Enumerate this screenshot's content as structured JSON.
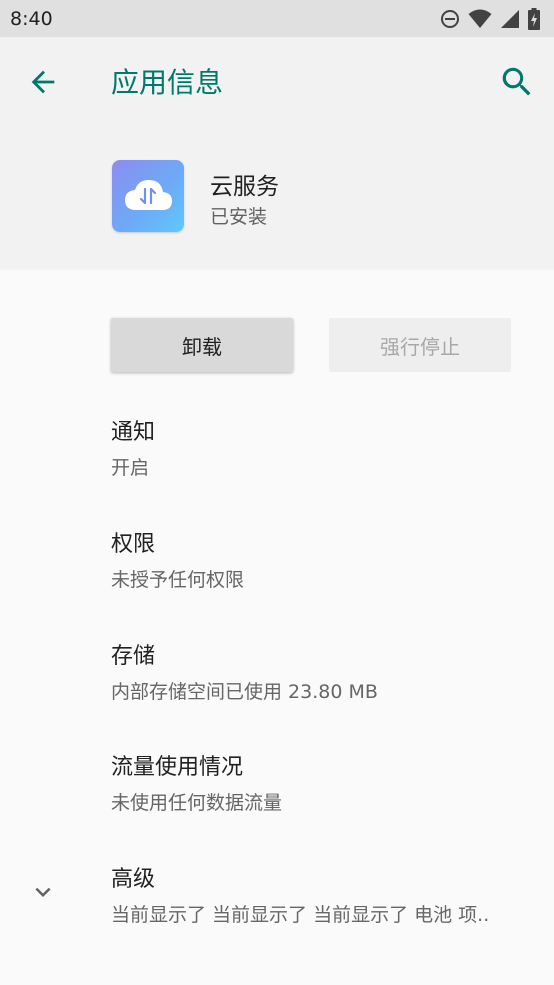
{
  "status_bar": {
    "time": "8:40"
  },
  "app_bar": {
    "title": "应用信息"
  },
  "app": {
    "name": "云服务",
    "status": "已安装"
  },
  "buttons": {
    "uninstall": "卸载",
    "force_stop": "强行停止"
  },
  "items": [
    {
      "title": "通知",
      "summary": "开启"
    },
    {
      "title": "权限",
      "summary": "未授予任何权限"
    },
    {
      "title": "存储",
      "summary": "内部存储空间已使用 23.80 MB"
    },
    {
      "title": "流量使用情况",
      "summary": "未使用任何数据流量"
    },
    {
      "title": "高级",
      "summary": "当前显示了 当前显示了 当前显示了 电池 项.."
    }
  ],
  "colors": {
    "accent": "#00796b",
    "status_bar_bg": "#e0e0e0",
    "header_bg": "#f2f2f2"
  }
}
